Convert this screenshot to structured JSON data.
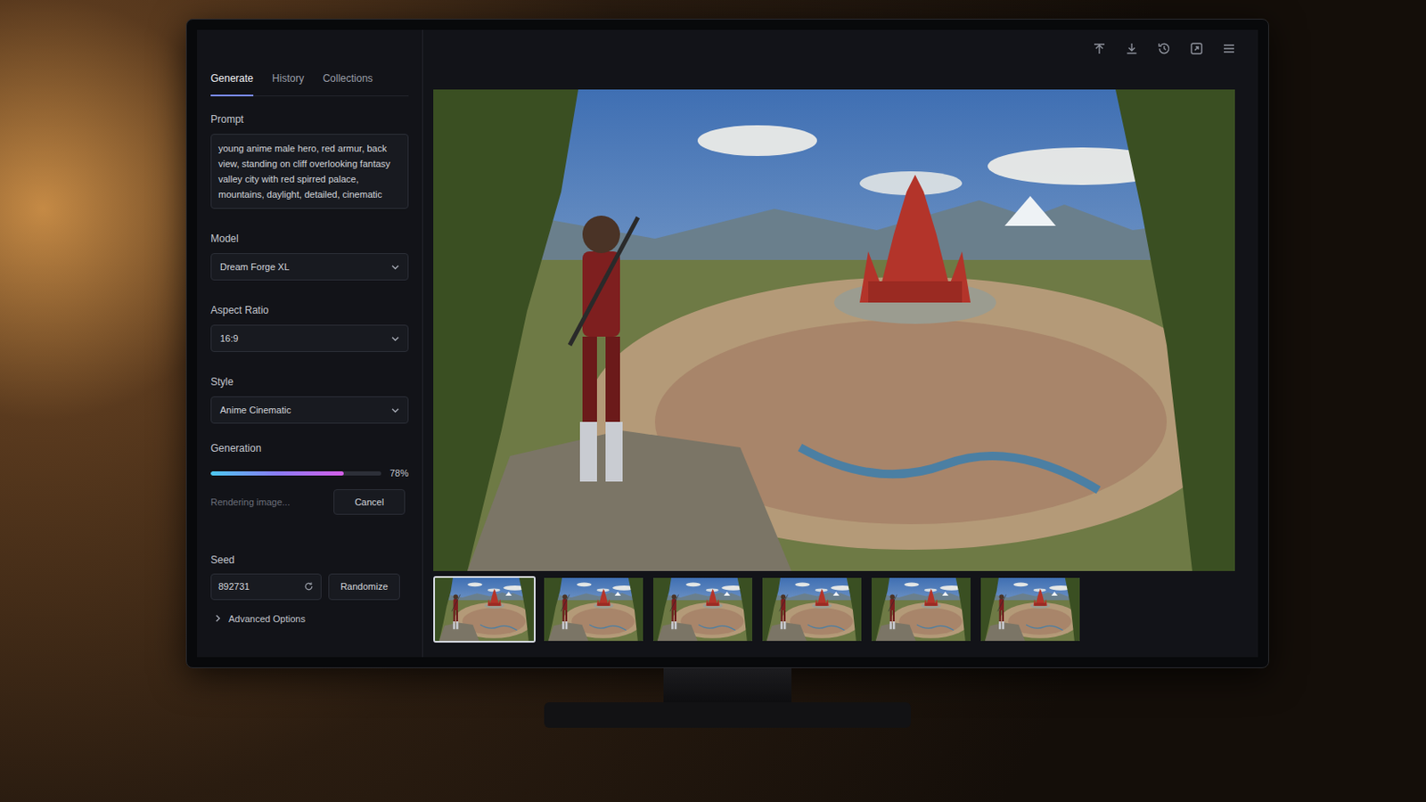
{
  "tabs": [
    {
      "label": "Generate",
      "selected": true
    },
    {
      "label": "History",
      "selected": false
    },
    {
      "label": "Collections",
      "selected": false
    }
  ],
  "prompt": {
    "label": "Prompt",
    "value": "young anime male hero, red armur, back view, standing on cliff overlooking fantasy valley city with red spirred palace, mountains, daylight, detailed, cinematic"
  },
  "fields": [
    {
      "label": "Model",
      "value": "Dream Forge XL"
    },
    {
      "label": "Aspect Ratio",
      "value": "16:9"
    },
    {
      "label": "Style",
      "value": "Anime Cinematic"
    }
  ],
  "generation": {
    "label": "Generation",
    "level": 0.78,
    "reading": "78%",
    "status": "Rendering image...",
    "cancel": "Cancel"
  },
  "seed": {
    "label": "Seed",
    "value": "892731",
    "randomize": "Randomize"
  },
  "advanced": {
    "label": "Advanced Options",
    "expanded": false
  },
  "thumbnails": [
    {
      "selected": true
    },
    {
      "selected": false
    },
    {
      "selected": false
    },
    {
      "selected": false
    },
    {
      "selected": false
    },
    {
      "selected": false
    }
  ]
}
